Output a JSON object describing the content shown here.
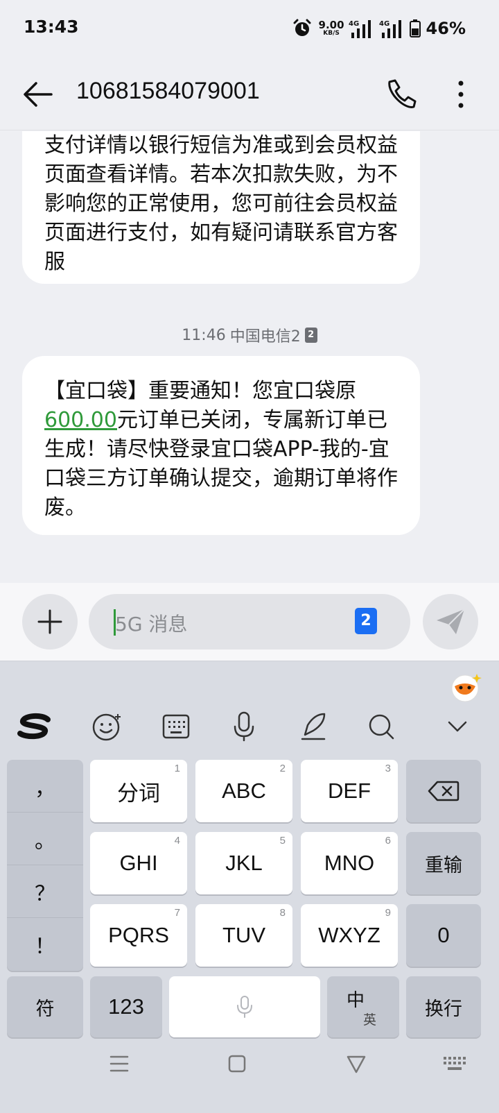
{
  "status": {
    "time": "13:43",
    "net_speed_value": "9.00",
    "net_speed_unit": "KB/S",
    "network_1": "4G",
    "network_2": "4G",
    "battery": "46%"
  },
  "header": {
    "contact": "10681584079001"
  },
  "thread": {
    "messages": [
      {
        "text": "支付详情以银行短信为准或到会员权益页面查看详情。若本次扣款失败，为不影响您的正常使用，您可前往会员权益页面进行支付，如有疑问请联系官方客服"
      },
      {
        "text_before": "【宜口袋】重要通知！您宜口袋原",
        "amount": "600.00",
        "text_after": "元订单已关闭，专属新订单已生成！请尽快登录宜口袋APP-我的-宜口袋三方订单确认提交，逾期订单将作废。"
      }
    ],
    "separator_time": "11:46",
    "separator_carrier": "中国电信2",
    "sim_number": "2"
  },
  "composer": {
    "placeholder": "5G 消息",
    "sim_number": "2"
  },
  "keyboard": {
    "punctuation": [
      "，",
      "。",
      "？",
      "！"
    ],
    "keys": [
      {
        "label": "分词",
        "num": "1"
      },
      {
        "label": "ABC",
        "num": "2"
      },
      {
        "label": "DEF",
        "num": "3"
      },
      {
        "label": "GHI",
        "num": "4"
      },
      {
        "label": "JKL",
        "num": "5"
      },
      {
        "label": "MNO",
        "num": "6"
      },
      {
        "label": "PQRS",
        "num": "7"
      },
      {
        "label": "TUV",
        "num": "8"
      },
      {
        "label": "WXYZ",
        "num": "9"
      }
    ],
    "reinput": "重输",
    "zero": "0",
    "symbols": "符",
    "numbers": "123",
    "lang_main": "中",
    "lang_alt": "英",
    "enter": "换行"
  },
  "colors": {
    "accent_green": "#2f9a3a",
    "sim_blue": "#1b6ef3"
  }
}
